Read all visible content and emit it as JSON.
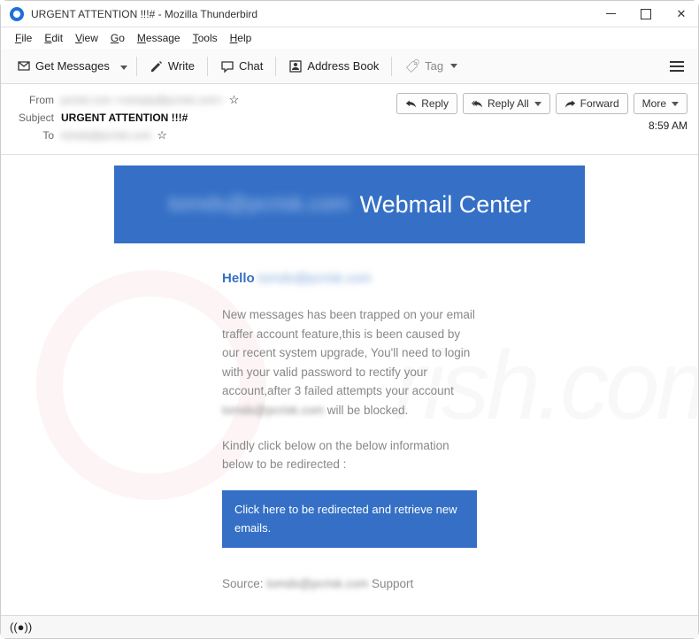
{
  "window": {
    "title": "URGENT ATTENTION !!!# - Mozilla Thunderbird"
  },
  "menu": {
    "file": "File",
    "edit": "Edit",
    "view": "View",
    "go": "Go",
    "message": "Message",
    "tools": "Tools",
    "help": "Help"
  },
  "toolbar": {
    "get_messages": "Get Messages",
    "write": "Write",
    "chat": "Chat",
    "address_book": "Address Book",
    "tag": "Tag"
  },
  "header": {
    "from_label": "From",
    "from_value": "pcrisk.com <noreply@pcrisk.com>",
    "subject_label": "Subject",
    "subject_value": "URGENT ATTENTION !!!#",
    "to_label": "To",
    "to_value": "tomds@pcrisk.com",
    "time": "8:59 AM"
  },
  "actions": {
    "reply": "Reply",
    "reply_all": "Reply All",
    "forward": "Forward",
    "more": "More"
  },
  "email": {
    "banner_blur": "tomds@pcrisk.com",
    "banner_title": "Webmail Center",
    "greeting_prefix": "Hello",
    "greeting_name": "tomds@pcrisk.com",
    "para1a": "New messages has been trapped on your email traffer account feature,this is been caused by our recent system upgrade, You'll need to login with your valid password to rectify your account,after 3 failed attempts your account ",
    "para1_blur": "tomds@pcrisk.com",
    "para1b": " will be blocked.",
    "para2": "Kindly click below on the below information below to be redirected :",
    "cta": "Click here to be redirected and retrieve new emails.",
    "source_prefix": "Source: ",
    "source_blur": "tomds@pcrisk.com",
    "source_suffix": "   Support"
  },
  "watermark": {
    "text": "rish.com"
  }
}
